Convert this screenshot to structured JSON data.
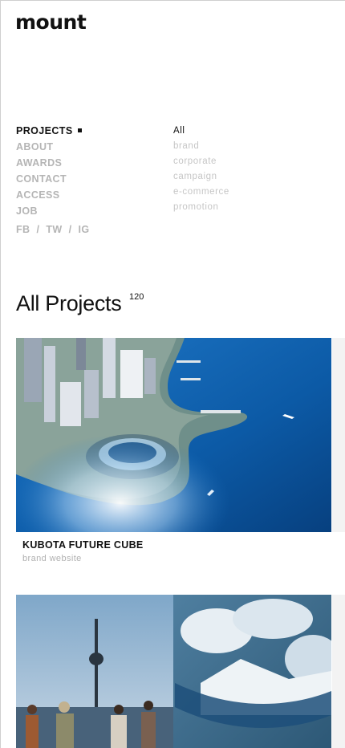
{
  "header": {
    "logo": "mount"
  },
  "nav": {
    "main": [
      {
        "label": "PROJECTS",
        "active": true
      },
      {
        "label": "ABOUT"
      },
      {
        "label": "AWARDS"
      },
      {
        "label": "CONTACT"
      },
      {
        "label": "ACCESS"
      },
      {
        "label": "JOB"
      }
    ],
    "social": {
      "fb": "FB",
      "tw": "TW",
      "ig": "IG",
      "separator": "/"
    },
    "categories": [
      {
        "label": "All",
        "active": true
      },
      {
        "label": "brand"
      },
      {
        "label": "corporate"
      },
      {
        "label": "campaign"
      },
      {
        "label": "e-commerce"
      },
      {
        "label": "promotion"
      }
    ]
  },
  "section": {
    "title": "All Projects",
    "count": "120"
  },
  "projects": [
    {
      "title": "KUBOTA FUTURE CUBE",
      "subtitle": "brand website"
    },
    {
      "title": "",
      "subtitle": ""
    }
  ],
  "colors": {
    "text": "#111111",
    "muted": "#b5b5b5",
    "sea": "#0d5aa8"
  }
}
